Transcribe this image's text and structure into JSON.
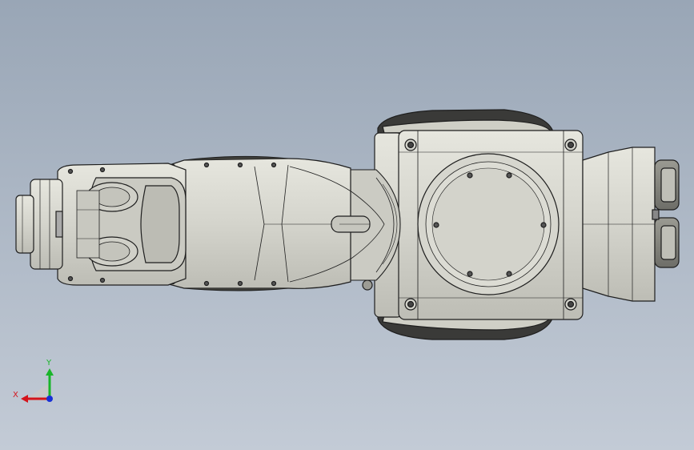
{
  "viewport": {
    "background_top": "#99a6b6",
    "background_bottom": "#c3cbd6",
    "model_fill": "#d8d8d0",
    "model_edge": "#202020",
    "model_shadow": "#2a2a2a"
  },
  "triad": {
    "x_label": "X",
    "y_label": "Y",
    "x_color": "#d4141b",
    "y_color": "#19b52a",
    "z_color": "#1730d6"
  }
}
